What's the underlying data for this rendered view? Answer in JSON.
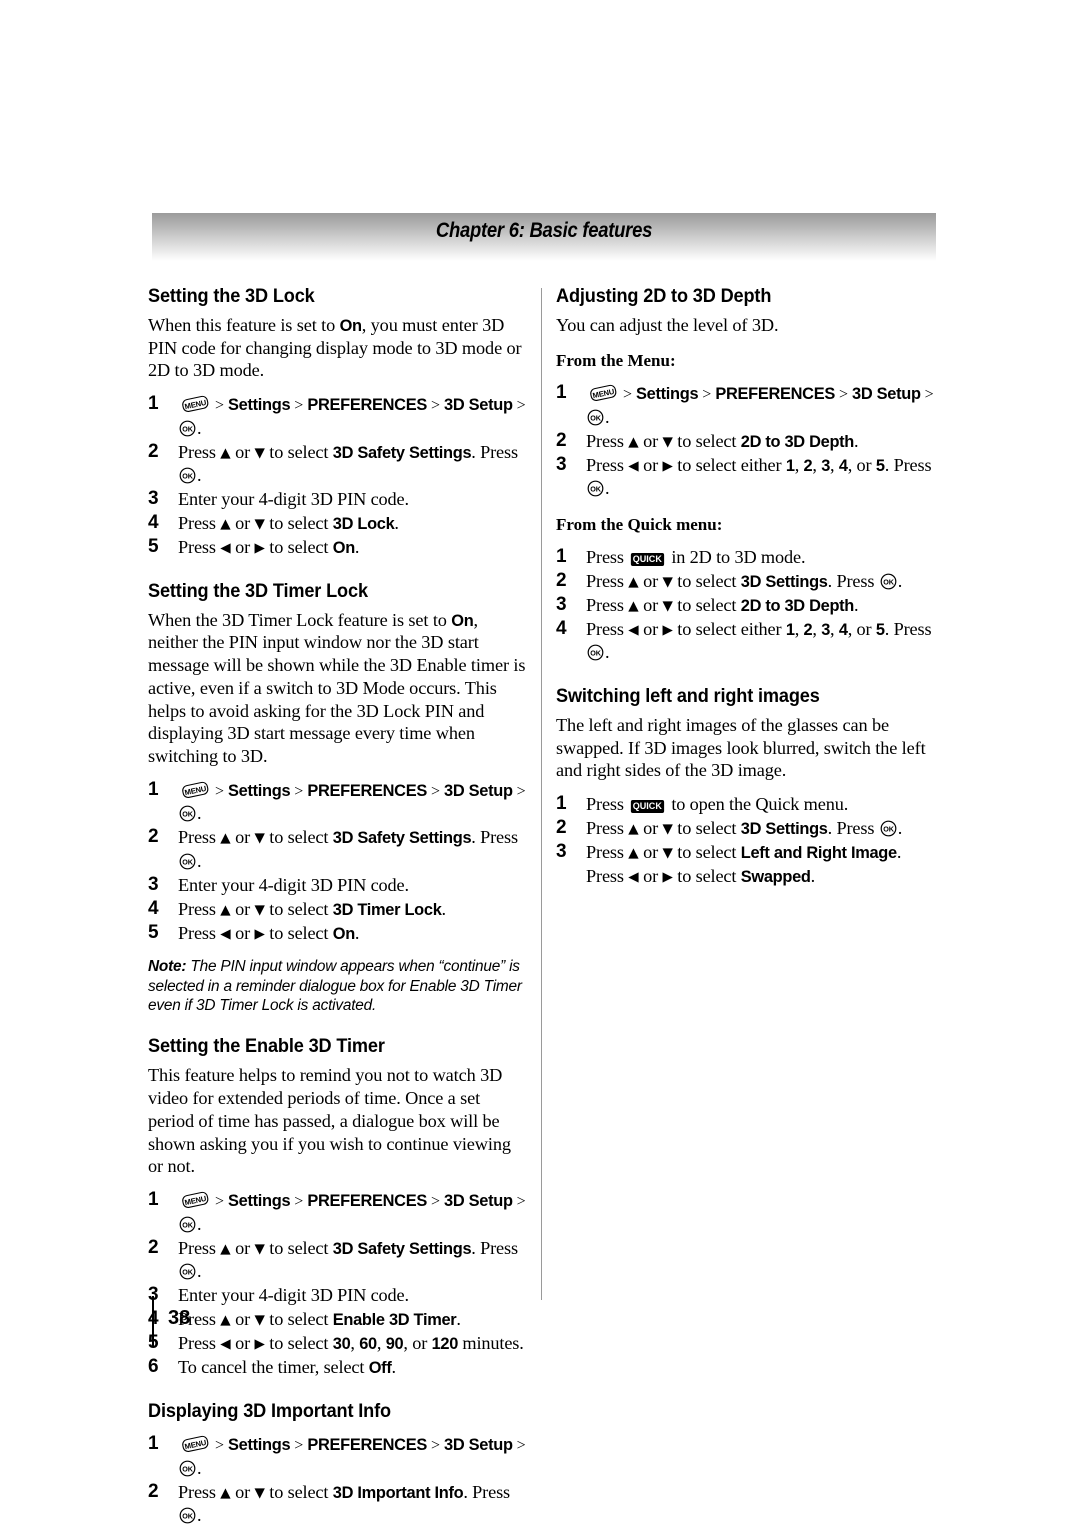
{
  "header": {
    "chapter_title": "Chapter 6: Basic features"
  },
  "footer": {
    "page_number": "38"
  },
  "icons": {
    "menu": "menu-button-icon",
    "ok": "ok-button-icon",
    "quick": "quick-button-icon",
    "quick_label": "QUICK",
    "ok_label": "OK",
    "menu_label": "MENU",
    "up_arrow": "▲",
    "down_arrow": "▼",
    "left_arrow": "◀",
    "right_arrow": "▶",
    "separator": ">"
  },
  "left_column": [
    {
      "id": "setting-the-3d-lock",
      "heading": "Setting the 3D Lock",
      "intro": {
        "pre": "When this feature is set to ",
        "bold": "On",
        "post": ", you must enter 3D PIN code for changing display mode to 3D mode or 2D to 3D mode."
      },
      "steps": [
        {
          "n": "1",
          "type": "menu-path",
          "parts": [
            "Settings",
            "PREFERENCES",
            "3D Setup"
          ]
        },
        {
          "n": "2",
          "type": "press-ud",
          "pre": "Press ",
          "mid": " or ",
          "post": " to select ",
          "bold": "3D Safety Settings",
          "tail": ". Press ",
          "tail2": "."
        },
        {
          "n": "3",
          "type": "plain",
          "text": "Enter your 4-digit 3D PIN code."
        },
        {
          "n": "4",
          "type": "press-ud-simple",
          "pre": "Press ",
          "mid": " or ",
          "post": " to select ",
          "bold": "3D Lock",
          "tail": "."
        },
        {
          "n": "5",
          "type": "press-lr-simple",
          "pre": "Press ",
          "mid": " or ",
          "post": " to select ",
          "bold": "On",
          "tail": "."
        }
      ]
    },
    {
      "id": "setting-the-3d-timer-lock",
      "heading": "Setting the 3D Timer Lock",
      "intro": {
        "pre": "When the 3D Timer Lock feature is set to ",
        "bold": "On",
        "post": ", neither the PIN input window nor the 3D start message will be shown while the 3D Enable timer is active, even if a switch to 3D Mode occurs. This helps to avoid asking for the 3D Lock PIN and displaying 3D start message every time when switching to 3D."
      },
      "steps": [
        {
          "n": "1",
          "type": "menu-path",
          "parts": [
            "Settings",
            "PREFERENCES",
            "3D Setup"
          ]
        },
        {
          "n": "2",
          "type": "press-ud",
          "pre": "Press ",
          "mid": " or ",
          "post": " to select ",
          "bold": "3D Safety Settings",
          "tail": ". Press ",
          "tail2": "."
        },
        {
          "n": "3",
          "type": "plain",
          "text": "Enter your 4-digit 3D PIN code."
        },
        {
          "n": "4",
          "type": "press-ud-simple",
          "pre": "Press ",
          "mid": " or ",
          "post": " to select ",
          "bold": "3D Timer Lock",
          "tail": "."
        },
        {
          "n": "5",
          "type": "press-lr-simple",
          "pre": "Press ",
          "mid": " or ",
          "post": " to select ",
          "bold": "On",
          "tail": "."
        }
      ],
      "note": {
        "label": "Note:",
        "text": " The PIN input window appears when “continue” is selected in a reminder dialogue box for Enable 3D Timer even if 3D Timer Lock is activated."
      }
    },
    {
      "id": "setting-the-enable-3d-timer",
      "heading": "Setting the Enable 3D Timer",
      "intro": {
        "pre": "This feature helps to remind you not to watch 3D video for extended periods of time. Once a set period of time has passed, a dialogue box will be shown asking you if you wish to continue viewing or not.",
        "bold": "",
        "post": ""
      },
      "steps": [
        {
          "n": "1",
          "type": "menu-path",
          "parts": [
            "Settings",
            "PREFERENCES",
            "3D Setup"
          ]
        },
        {
          "n": "2",
          "type": "press-ud",
          "pre": "Press ",
          "mid": " or ",
          "post": " to select ",
          "bold": "3D Safety Settings",
          "tail": ". Press ",
          "tail2": "."
        },
        {
          "n": "3",
          "type": "plain",
          "text": "Enter your 4-digit 3D PIN code."
        },
        {
          "n": "4",
          "type": "press-ud-simple",
          "pre": "Press ",
          "mid": " or ",
          "post": " to select ",
          "bold": "Enable 3D Timer",
          "tail": "."
        },
        {
          "n": "5",
          "type": "press-lr-values",
          "pre": "Press ",
          "mid": " or ",
          "post": " to select ",
          "values": [
            "30",
            "60",
            "90",
            "120"
          ],
          "tail": " minutes."
        },
        {
          "n": "6",
          "type": "plain-bold-tail",
          "pre": "To cancel the timer, select ",
          "bold": "Off",
          "tail": "."
        }
      ]
    },
    {
      "id": "displaying-3d-important-info",
      "heading": "Displaying 3D Important Info",
      "intro": null,
      "steps": [
        {
          "n": "1",
          "type": "menu-path",
          "parts": [
            "Settings",
            "PREFERENCES",
            "3D Setup"
          ]
        },
        {
          "n": "2",
          "type": "press-ud",
          "pre": "Press ",
          "mid": " or ",
          "post": " to select ",
          "bold": "3D Important Info",
          "tail": ". Press ",
          "tail2": "."
        }
      ]
    }
  ],
  "right_column": [
    {
      "id": "adjusting-2d-to-3d-depth",
      "heading": "Adjusting 2D to 3D Depth",
      "intro": {
        "pre": "You can adjust the level of 3D.",
        "bold": "",
        "post": ""
      },
      "subsections": [
        {
          "subhead": "From the Menu:",
          "steps": [
            {
              "n": "1",
              "type": "menu-path",
              "parts": [
                "Settings",
                "PREFERENCES",
                "3D Setup"
              ]
            },
            {
              "n": "2",
              "type": "press-ud-simple",
              "pre": "Press ",
              "mid": " or ",
              "post": " to select ",
              "bold": "2D to 3D Depth",
              "tail": "."
            },
            {
              "n": "3",
              "type": "press-lr-range",
              "pre": "Press ",
              "mid": " or ",
              "post": " to select either ",
              "values": [
                "1",
                "2",
                "3",
                "4",
                "5"
              ],
              "tail": ". Press ",
              "tail2": "."
            }
          ]
        },
        {
          "subhead": "From the Quick menu:",
          "steps": [
            {
              "n": "1",
              "type": "quick-press",
              "pre": "Press ",
              "post": " in 2D to 3D mode."
            },
            {
              "n": "2",
              "type": "press-ud",
              "pre": "Press ",
              "mid": " or ",
              "post": " to select ",
              "bold": "3D Settings",
              "tail": ". Press ",
              "tail2": "."
            },
            {
              "n": "3",
              "type": "press-ud-simple",
              "pre": "Press ",
              "mid": " or ",
              "post": " to select ",
              "bold": "2D to 3D Depth",
              "tail": "."
            },
            {
              "n": "4",
              "type": "press-lr-range",
              "pre": "Press ",
              "mid": " or ",
              "post": " to select either ",
              "values": [
                "1",
                "2",
                "3",
                "4",
                "5"
              ],
              "tail": ". Press ",
              "tail2": "."
            }
          ]
        }
      ]
    },
    {
      "id": "switching-left-and-right-images",
      "heading": "Switching left and right images",
      "intro": {
        "pre": "The left and right images of the glasses can be swapped. If 3D images look blurred, switch the left and right sides of the 3D image.",
        "bold": "",
        "post": ""
      },
      "subsections": [
        {
          "subhead": null,
          "steps": [
            {
              "n": "1",
              "type": "quick-press",
              "pre": "Press ",
              "post": " to open the Quick menu."
            },
            {
              "n": "2",
              "type": "press-ud",
              "pre": "Press ",
              "mid": " or ",
              "post": " to select ",
              "bold": "3D Settings",
              "tail": ". Press ",
              "tail2": "."
            },
            {
              "n": "3",
              "type": "press-ud-then-lr",
              "pre": "Press ",
              "mid": " or ",
              "post": " to select ",
              "bold": "Left and Right Image",
              "tail": ". Press ",
              "pre2": " or ",
              "post2": " to select ",
              "bold2": "Swapped",
              "tail3": "."
            }
          ]
        }
      ]
    }
  ]
}
